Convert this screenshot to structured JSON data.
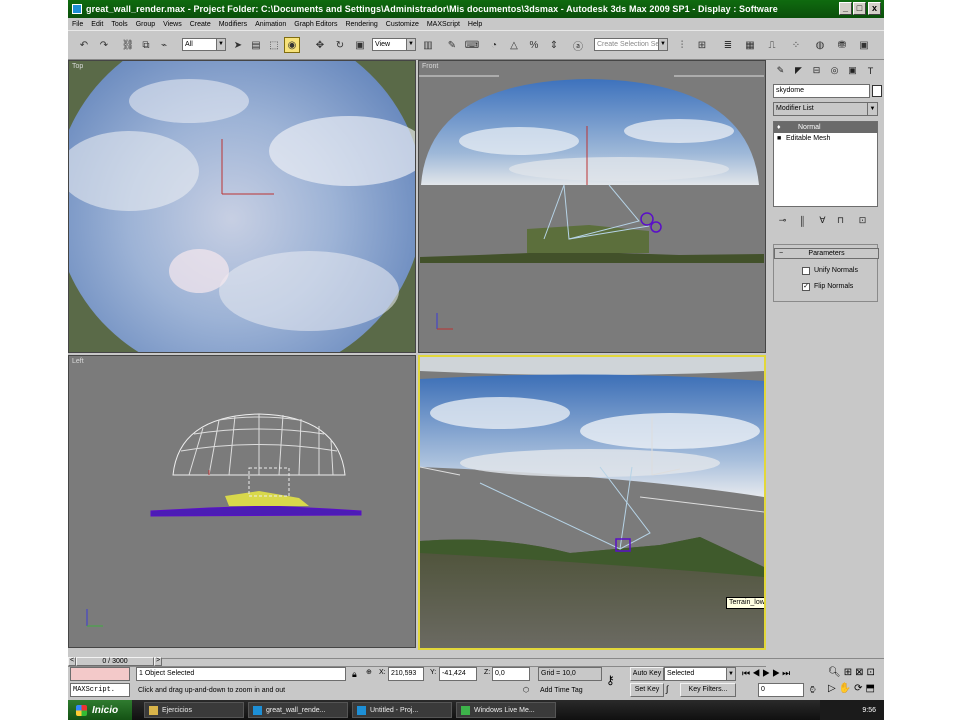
{
  "window": {
    "title": "great_wall_render.max    - Project Folder: C:\\Documents and Settings\\Administrador\\Mis documentos\\3dsmax    - Autodesk 3ds Max  2009 SP1      - Display : Software",
    "minimize": "_",
    "maximize": "□",
    "close": "x"
  },
  "menu": [
    "File",
    "Edit",
    "Tools",
    "Group",
    "Views",
    "Create",
    "Modifiers",
    "Animation",
    "Graph Editors",
    "Rendering",
    "Customize",
    "MAXScript",
    "Help"
  ],
  "toolbar": {
    "selection_filter": "All",
    "reference_coord": "View",
    "named_selection_placeholder": "Create Selection Se"
  },
  "viewports": {
    "top": "Top",
    "front": "Front",
    "left": "Left",
    "perspective_tooltip": "Terrain_low"
  },
  "command_panel": {
    "object_name": "skydome",
    "modifier_list": "Modifier List",
    "stack": [
      "Normal",
      "Editable Mesh"
    ],
    "rollout_title": "Parameters",
    "unify_normals": "Unify Normals",
    "flip_normals": "Flip Normals",
    "flip_checked": "✓"
  },
  "status": {
    "frame_counter": "0 / 3000",
    "nav_prev": "<",
    "nav_next": ">",
    "maxscript": "MAXScript.",
    "selection_info": "1 Object Selected",
    "prompt": "Click and drag up-and-down to zoom in and out",
    "x_label": "X:",
    "x_value": "210,593",
    "y_label": "Y:",
    "y_value": "-41,424",
    "z_label": "Z:",
    "z_value": "0,0",
    "grid": "Grid = 10,0",
    "add_time_tag": "Add Time Tag",
    "auto_key": "Auto Key",
    "set_key": "Set Key",
    "key_mode": "Selected",
    "key_filters": "Key Filters...",
    "current_frame": "0"
  },
  "taskbar": {
    "start": "Inicio",
    "items": [
      "Ejercicios",
      "great_wall_rende...",
      "Untitled    - Proj...",
      "Windows Live Me..."
    ],
    "clock": "9:56"
  },
  "colors": {
    "titlebar": "#0f6b0f",
    "viewport_bg": "#7b7b7b",
    "active_viewport_border": "#e2d73a",
    "wireframe_purple": "#5a0fc8"
  }
}
